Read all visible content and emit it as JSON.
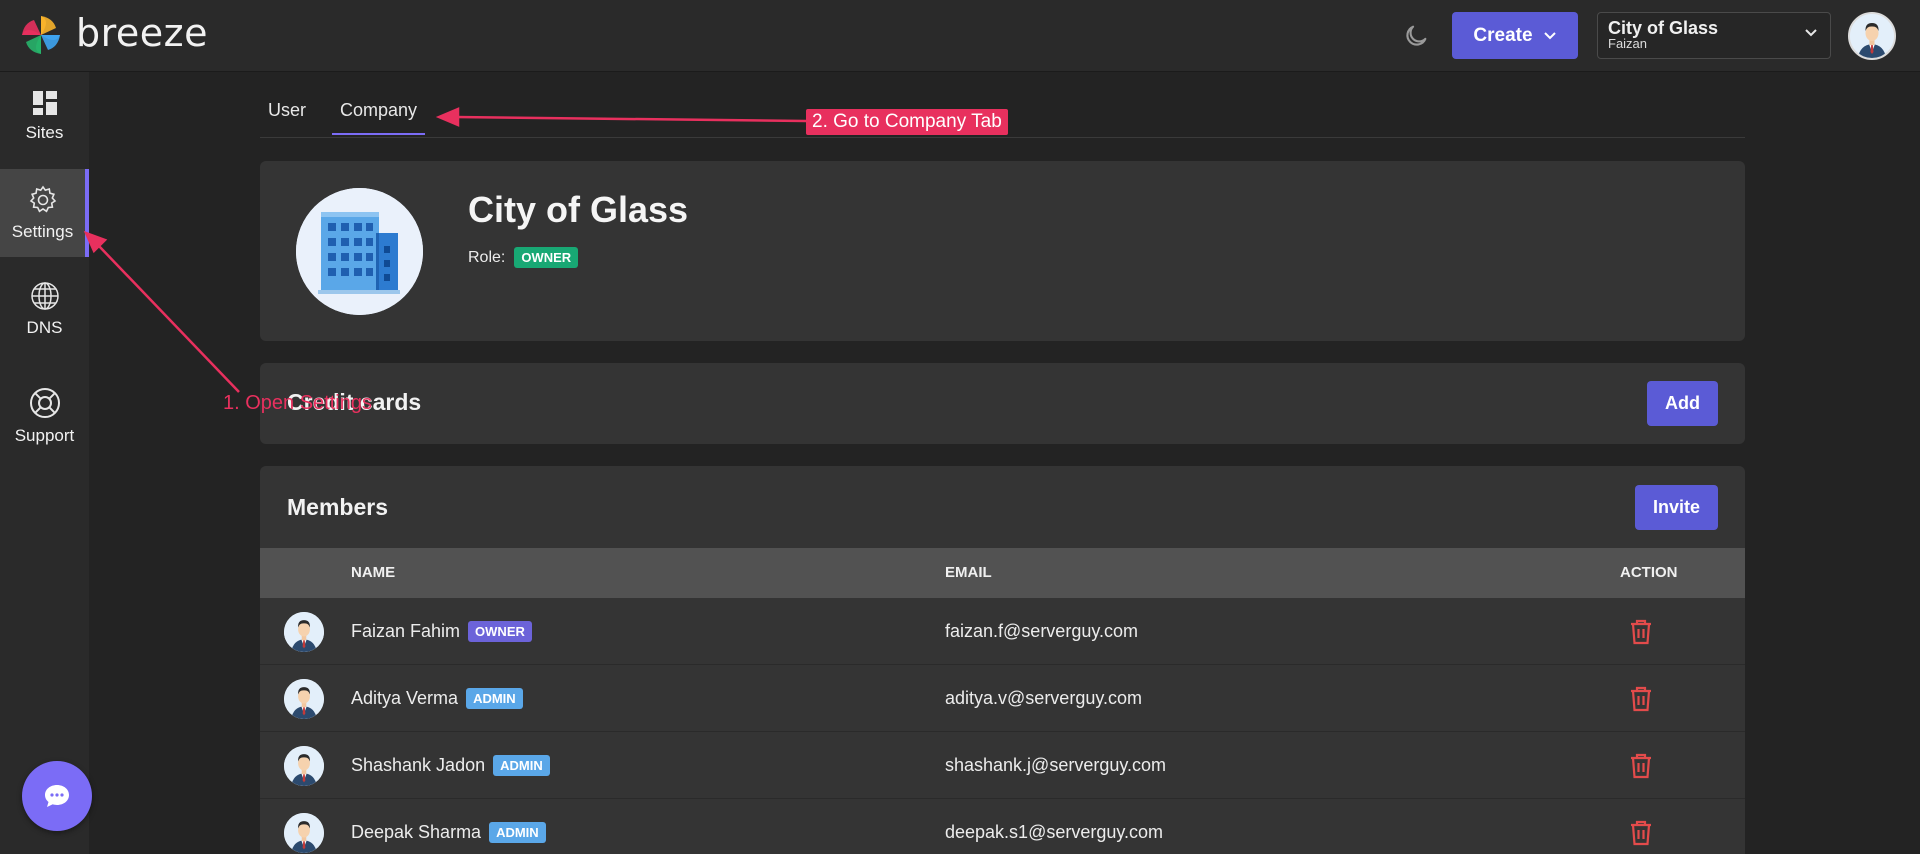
{
  "app": {
    "brand": "breeze",
    "accent": "#5b5bd6",
    "annotation_color": "#e8305e"
  },
  "header": {
    "create_label": "Create",
    "company_select": {
      "title": "City of Glass",
      "subtitle": "Faizan"
    }
  },
  "sidebar": {
    "items": [
      {
        "label": "Sites",
        "icon": "dashboard-icon"
      },
      {
        "label": "Settings",
        "icon": "gear-icon",
        "active": true
      },
      {
        "label": "DNS",
        "icon": "globe-icon"
      },
      {
        "label": "Support",
        "icon": "lifebuoy-icon"
      }
    ]
  },
  "tabs": [
    {
      "label": "User"
    },
    {
      "label": "Company",
      "active": true
    }
  ],
  "profile": {
    "company_name": "City of Glass",
    "role_label": "Role:",
    "role_badge": "OWNER"
  },
  "credit_cards": {
    "title": "Credit cards",
    "add_label": "Add"
  },
  "members": {
    "title": "Members",
    "invite_label": "Invite",
    "columns": [
      "NAME",
      "EMAIL",
      "ACTION"
    ],
    "rows": [
      {
        "name": "Faizan Fahim",
        "badge": "OWNER",
        "email": "faizan.f@serverguy.com"
      },
      {
        "name": "Aditya Verma",
        "badge": "ADMIN",
        "email": "aditya.v@serverguy.com"
      },
      {
        "name": "Shashank Jadon",
        "badge": "ADMIN",
        "email": "shashank.j@serverguy.com"
      },
      {
        "name": "Deepak Sharma",
        "badge": "ADMIN",
        "email": "deepak.s1@serverguy.com"
      }
    ]
  },
  "annotations": {
    "step1": "1. Open Settings",
    "step2": "2. Go to Company Tab"
  }
}
